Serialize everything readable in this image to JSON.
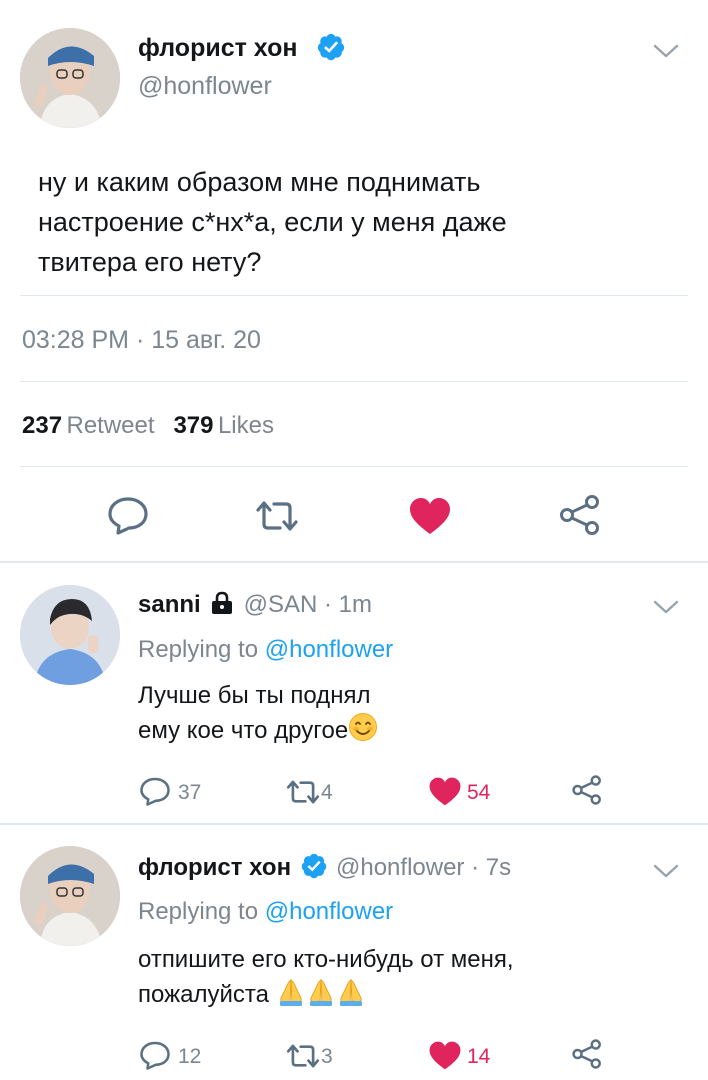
{
  "main_tweet": {
    "display_name": "флорист хон",
    "handle": "@honflower",
    "text_line1": "ну и каким образом мне поднимать",
    "text_line2": "настроение с*нх*а, если у меня даже",
    "text_line3": "твитера его нету?",
    "timestamp": "03:28 PM · 15 авг. 20",
    "retweets": "237",
    "retweet_label": "Retweet",
    "likes": "379",
    "likes_label": "Likes"
  },
  "replies": [
    {
      "display_name": "sanni",
      "handle_time": "@SAN · 1m",
      "replying_prefix": "Replying to",
      "replying_handle": "@honflower",
      "text_line1": "Лучше бы ты поднял",
      "text_line2": "ему кое что другое",
      "reply_count": "37",
      "retweet_count": "4",
      "like_count": "54"
    },
    {
      "display_name": "флорист хон",
      "handle_time": "@honflower · 7s",
      "replying_prefix": "Replying to",
      "replying_handle": "@honflower",
      "text_line1": "отпишите его кто-нибудь от меня,",
      "text_line2": "пожалуйста",
      "reply_count": "12",
      "retweet_count": "3",
      "like_count": "14"
    }
  ],
  "colors": {
    "accent": "#1da1f2",
    "like": "#e0245e",
    "muted": "#7b868f",
    "divider": "#e1e8ed"
  }
}
